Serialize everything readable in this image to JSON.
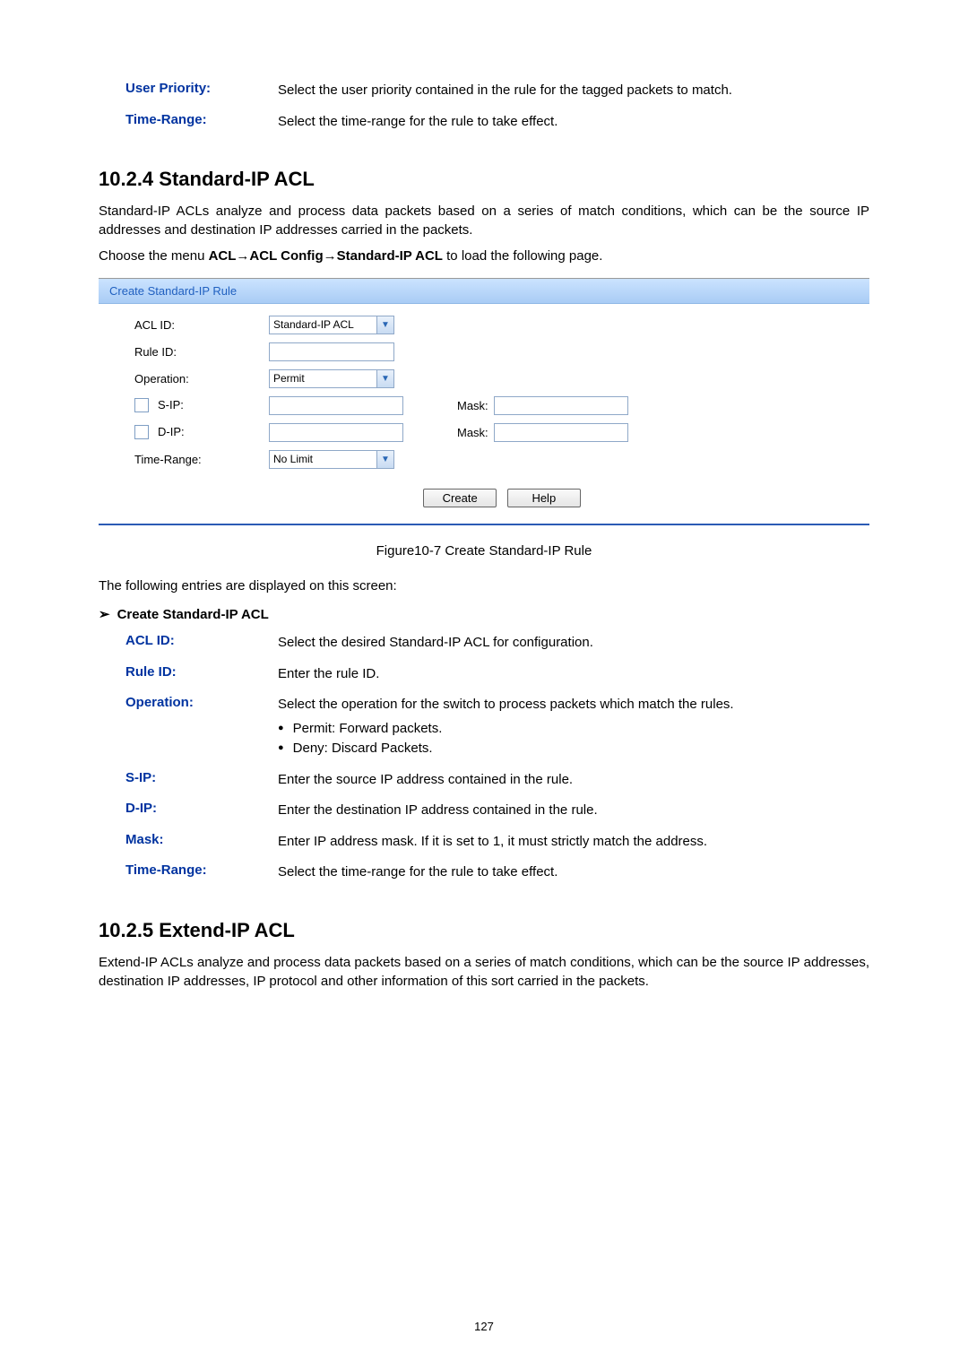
{
  "top_entries": [
    {
      "label": "User Priority:",
      "desc": "Select the user priority contained in the rule for the tagged packets to match."
    },
    {
      "label": "Time-Range:",
      "desc": "Select the time-range for the rule to take effect."
    }
  ],
  "section_1024": {
    "title": "10.2.4  Standard-IP ACL",
    "para1": "Standard-IP ACLs analyze and process data packets based on a series of match conditions, which can be the source IP addresses and destination IP addresses carried in the packets.",
    "para2_prefix": "Choose the menu ",
    "para2_bold": "ACL→ACL Config→Standard-IP ACL",
    "para2_suffix": " to load the following page."
  },
  "figure": {
    "panel_title": "Create Standard-IP Rule",
    "rows": {
      "acl_id": {
        "label": "ACL ID:",
        "value": "Standard-IP ACL"
      },
      "rule_id": {
        "label": "Rule ID:"
      },
      "operation": {
        "label": "Operation:",
        "value": "Permit"
      },
      "sip": {
        "label": "S-IP:",
        "mask": "Mask:"
      },
      "dip": {
        "label": "D-IP:",
        "mask": "Mask:"
      },
      "time_range": {
        "label": "Time-Range:",
        "value": "No Limit"
      }
    },
    "buttons": {
      "create": "Create",
      "help": "Help"
    },
    "caption": "Figure10-7 Create Standard-IP Rule"
  },
  "below_fig": {
    "intro": "The following entries are displayed on this screen:",
    "sub_head": "Create Standard-IP ACL",
    "entries": [
      {
        "label": "ACL ID:",
        "desc": "Select the desired Standard-IP ACL for configuration."
      },
      {
        "label": "Rule ID:",
        "desc": "Enter the rule ID."
      },
      {
        "label": "Operation:",
        "desc": "Select the operation for the switch to process packets which match the rules.",
        "bullets": [
          "Permit: Forward packets.",
          "Deny: Discard Packets."
        ]
      },
      {
        "label": "S-IP:",
        "desc": "Enter the source IP address contained in the rule."
      },
      {
        "label": "D-IP:",
        "desc": "Enter the destination IP address contained in the rule."
      },
      {
        "label": "Mask:",
        "desc": "Enter IP address mask. If it is set to 1, it must strictly match the address."
      },
      {
        "label": "Time-Range:",
        "desc": "Select the time-range for the rule to take effect."
      }
    ]
  },
  "section_1025": {
    "title": "10.2.5  Extend-IP ACL",
    "para": "Extend-IP ACLs analyze and process data packets based on a series of match conditions, which can be the source IP addresses, destination IP addresses, IP protocol and other information of this sort carried in the packets."
  },
  "page_number": "127"
}
